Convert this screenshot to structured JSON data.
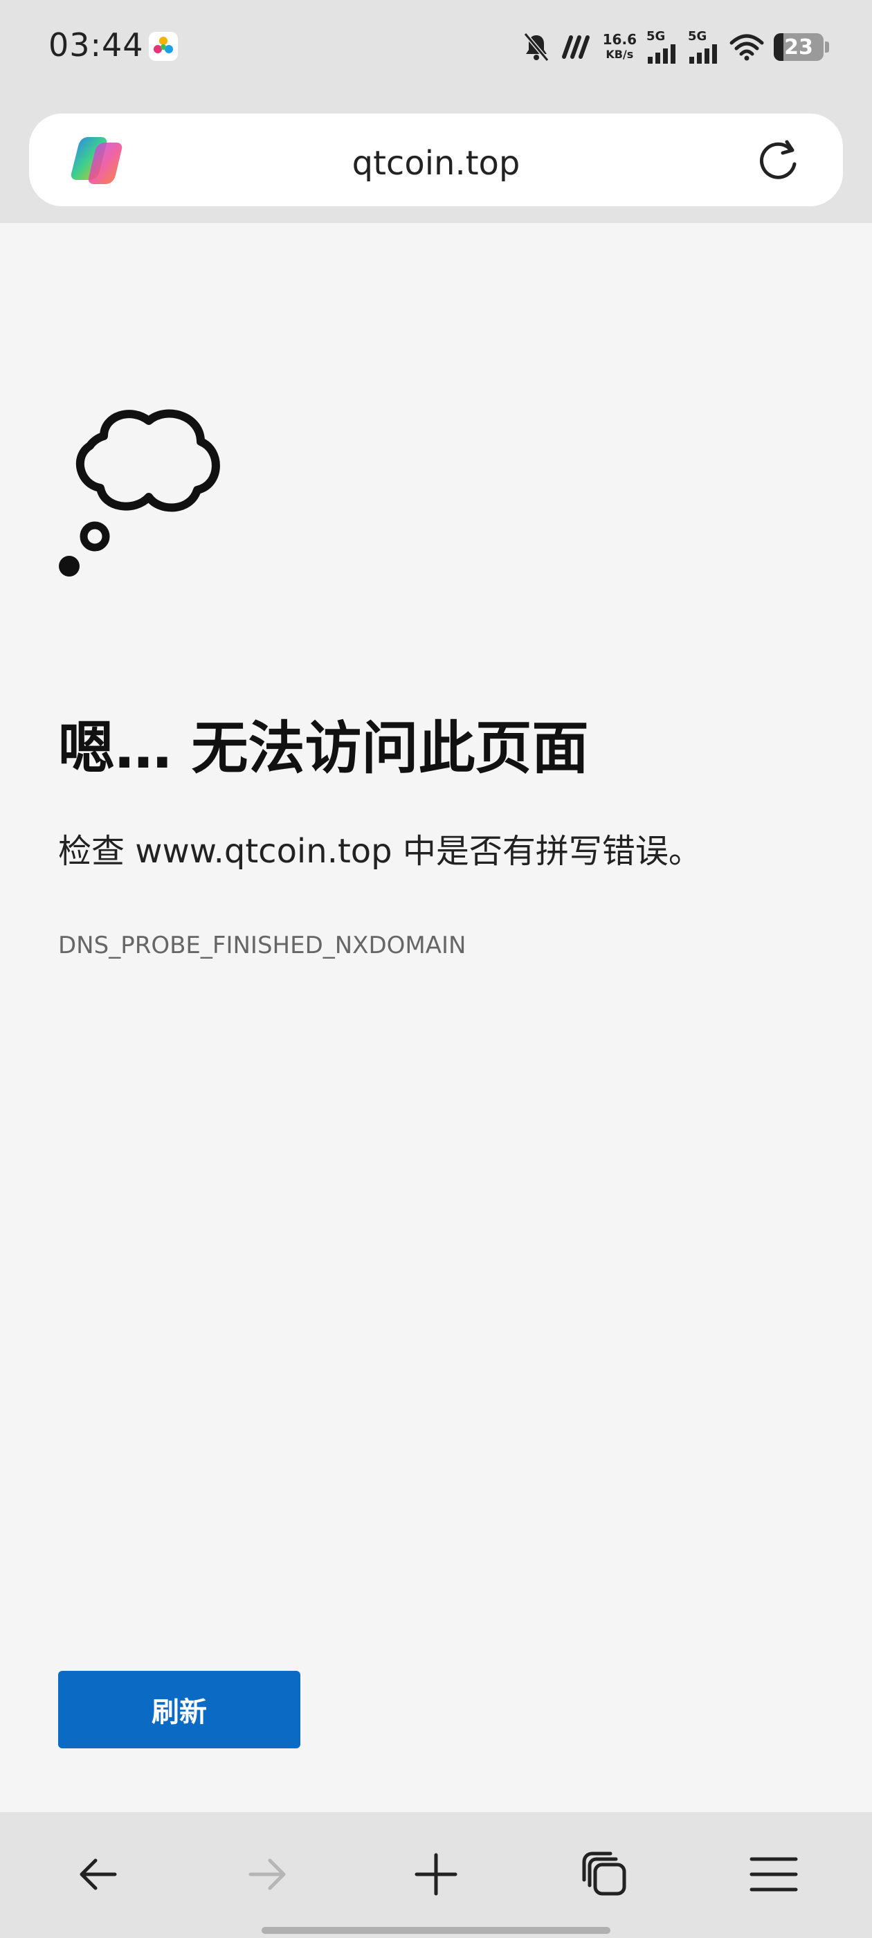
{
  "status_bar": {
    "time": "03:44",
    "speed_value": "16.6",
    "speed_unit": "KB/s",
    "sim1_label": "5G",
    "sim2_label": "5G",
    "battery_level": "23"
  },
  "address_bar": {
    "url": "qtcoin.top"
  },
  "error_page": {
    "title": "嗯… 无法访问此页面",
    "hint": "检查 www.qtcoin.top 中是否有拼写错误。",
    "code": "DNS_PROBE_FINISHED_NXDOMAIN",
    "refresh_label": "刷新"
  },
  "colors": {
    "accent": "#0a6ac4",
    "chrome_bg": "#e3e3e3",
    "page_bg": "#f5f5f5"
  },
  "icons": {
    "app_logo": "copilot-icon",
    "reload": "reload-icon",
    "illustration": "thought-bubble-icon",
    "back": "arrow-left-icon",
    "forward": "arrow-right-icon",
    "new_tab": "plus-icon",
    "tabs": "tabs-icon",
    "menu": "menu-icon"
  }
}
